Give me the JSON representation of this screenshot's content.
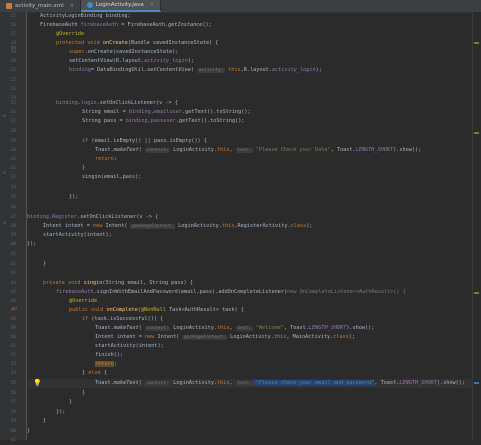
{
  "tabs": [
    {
      "label": "activity_main.xml",
      "icon": "xml-file-icon",
      "active": false
    },
    {
      "label": "LoginActivity.java",
      "icon": "java-class-icon",
      "active": true
    }
  ],
  "line_numbers": [
    "15",
    "16",
    "17",
    "18",
    "19",
    "20",
    "21",
    "22",
    "23",
    "24",
    "25",
    "26",
    "27",
    "28",
    "29",
    "30",
    "31",
    "32",
    "33",
    "34",
    "35",
    "36",
    "37",
    "38",
    "39",
    "40",
    "41",
    "42",
    "43",
    "44",
    "45",
    "46",
    "47",
    "48",
    "49",
    "50",
    "51",
    "52",
    "53",
    "54",
    "55",
    "56",
    "57",
    "58",
    "59",
    "60",
    "61",
    "62"
  ],
  "code": {
    "l15": "ActivityLoginBinding binding;",
    "l16a": "FirebaseAuth ",
    "l16b": "firebaseAuth",
    "l16c": " = FirebaseAuth.",
    "l16d": "getInstance",
    "l16e": "();",
    "l17": "@Override",
    "l18a": "protected void ",
    "l18b": "onCreate",
    "l18c": "(Bundle savedInstanceState) {",
    "l19a": "super",
    "l19b": ".onCreate(savedInstanceState);",
    "l20a": "setContentView(R.layout.",
    "l20b": "activity_login",
    "l20c": ");",
    "l21a": "binding",
    "l21b": "= DataBindingUtil.",
    "l21c": "setContentView",
    "l21d": "( ",
    "l21h": "activity:",
    "l21e": " this",
    "l21f": ",R.layout.",
    "l21g": "activity_login",
    "l21i": ");",
    "l24a": "binding",
    "l24b": ".",
    "l24c": "login",
    "l24d": ".setOnClickListener(v -> {",
    "l25a": "String email = ",
    "l25b": "binding",
    "l25c": ".",
    "l25d": "emailuser",
    "l25e": ".getText().toString();",
    "l26a": "String pass = ",
    "l26b": "binding",
    "l26c": ".",
    "l26d": "passuser",
    "l26e": ".getText().toString();",
    "l28a": "if ",
    "l28b": "(email.isEmpty() || pass.isEmpty()) {",
    "l29a": "Toast.",
    "l29b": "makeText",
    "l29c": "( ",
    "l29h": "context:",
    "l29d": " LoginActivity.",
    "l29e": "this",
    "l29f": ", ",
    "l29g": "text:",
    "l29i": " \"Please Check your Data\"",
    "l29j": ", Toast.",
    "l29k": "LENGTH_SHORT",
    "l29l": ").show();",
    "l30a": "return",
    "l30b": ";",
    "l31": "}",
    "l32": "singin(email,pass);",
    "l34": "});",
    "l36a": "binding",
    "l36b": ".",
    "l36c": "Register",
    "l36d": ".setOnClickListener(v -> {",
    "l37a": "Intent intent = ",
    "l37b": "new ",
    "l37c": "Intent( ",
    "l37h": "packageContext:",
    "l37d": " LoginActivity.",
    "l37e": "this",
    "l37f": ",RegisterActivity.",
    "l37g": "class",
    "l37i": ");",
    "l38": "startActivity(intent);",
    "l39": "});",
    "l41": "}",
    "l43a": "private void ",
    "l43b": "singin",
    "l43c": "(String email, String pass) {",
    "l44a": "firebaseAuth",
    "l44b": ".signInWithEmailAndPassword(email,pass).addOnCompleteListener(",
    "l44c": "new OnCompleteListener<AuthResult>() {",
    "l45": "@Override",
    "l46a": "public void ",
    "l46b": "onComplete",
    "l46c": "(",
    "l46d": "@NonNull",
    "l46e": " Task<AuthResult> task) {",
    "l47a": "if ",
    "l47b": "(task.isSuccessful()) {",
    "l48a": "Toast.",
    "l48b": "makeText",
    "l48c": "( ",
    "l48h": "context:",
    "l48d": " LoginActivity.",
    "l48e": "this",
    "l48f": ", ",
    "l48g": "text:",
    "l48i": " \"Welcome\"",
    "l48j": ", Toast.",
    "l48k": "LENGTH_SHORT",
    "l48l": ").show();",
    "l49a": "Intent intent = ",
    "l49b": "new ",
    "l49c": "Intent( ",
    "l49h": "packageContext:",
    "l49d": " LoginActivity.",
    "l49e": "this",
    "l49f": ", MainActivity.",
    "l49g": "class",
    "l49i": ");",
    "l50": "startActivity(intent);",
    "l51": "finish();",
    "l52a": "return",
    "l52b": ";",
    "l53a": "} ",
    "l53b": "else ",
    "l53c": "{",
    "l54a": "Toast.",
    "l54b": "makeText",
    "l54c": "( ",
    "l54h": "context:",
    "l54d": " LoginActivity.",
    "l54e": "this",
    "l54f": ", ",
    "l54g": "text:",
    "l54i": " \"Please check your email and password\"",
    "l54j": ", Toast.",
    "l54k": "LENGTH_SHORT",
    "l54l": ").show();",
    "l55": "}",
    "l56": "}",
    "l57": "});",
    "l58": "}",
    "l59": "}"
  },
  "colors": {
    "keyword": "#cc7832",
    "field": "#9876aa",
    "string": "#6a8759",
    "method": "#ffc66d",
    "annotation": "#bbb529",
    "selection": "#214283"
  },
  "gutter_icons": {
    "override": "override-icon",
    "implement": "implements-icon",
    "bulb": "lightbulb-icon"
  }
}
